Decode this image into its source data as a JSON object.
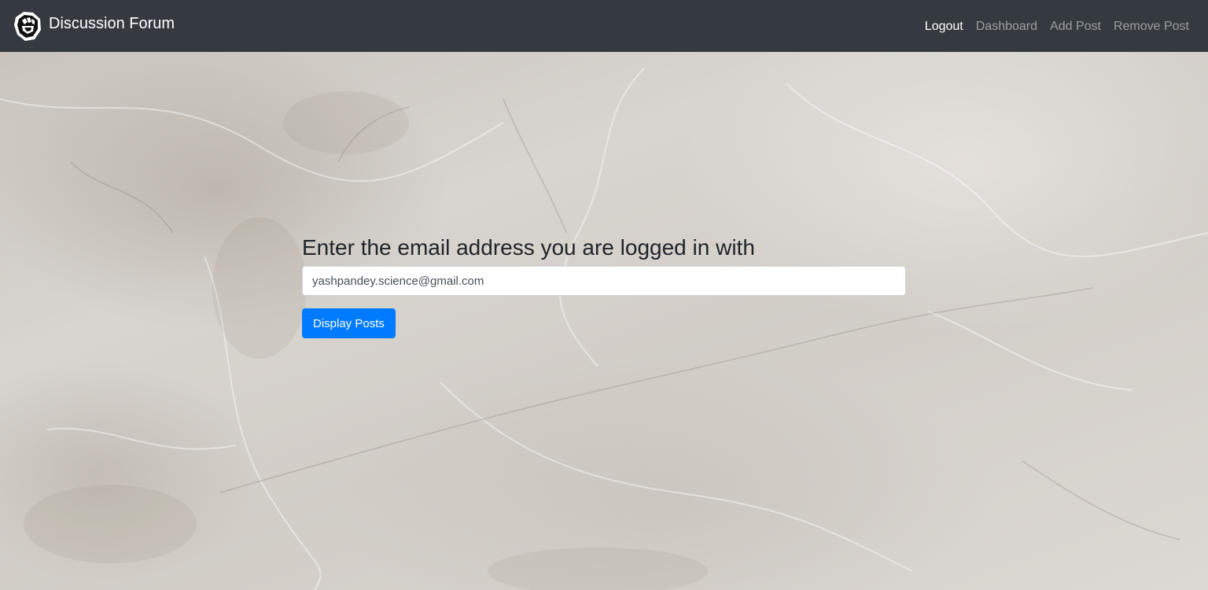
{
  "navbar": {
    "brand_title": "Discussion Forum",
    "logo_icon": "fist-logo-icon",
    "links": [
      {
        "label": "Logout",
        "active": true
      },
      {
        "label": "Dashboard",
        "active": false
      },
      {
        "label": "Add Post",
        "active": false
      },
      {
        "label": "Remove Post",
        "active": false
      }
    ]
  },
  "main": {
    "heading": "Enter the email address you are logged in with",
    "email_value": "yashpandey.science@gmail.com",
    "submit_label": "Display Posts"
  },
  "colors": {
    "navbar_bg": "#343a40",
    "primary_button": "#007bff",
    "background": "marble-texture"
  }
}
